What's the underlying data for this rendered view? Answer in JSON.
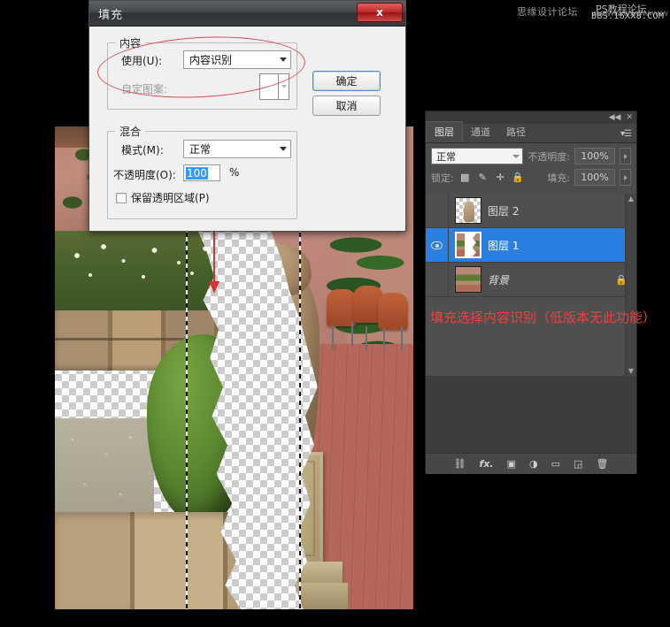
{
  "watermark": {
    "left_text": "思缘设计论坛",
    "dots": "wwwwwwwwwwww",
    "right_line1": "PS教程论坛",
    "right_line2": "BBS.16XX8.COM"
  },
  "dialog": {
    "title": "填充",
    "close_label": "x",
    "contents": {
      "legend": "内容",
      "use_label": "使用(U):",
      "use_value": "内容识别",
      "pattern_label": "自定图案:"
    },
    "blending": {
      "legend": "混合",
      "mode_label": "模式(M):",
      "mode_value": "正常",
      "opacity_label": "不透明度(O):",
      "opacity_value": "100",
      "percent": "%",
      "preserve_label": "保留透明区域(P)"
    },
    "buttons": {
      "ok": "确定",
      "cancel": "取消"
    }
  },
  "layers_panel": {
    "tabs": [
      {
        "label": "图层"
      },
      {
        "label": "通道"
      },
      {
        "label": "路径"
      }
    ],
    "collapse_icon": "◀◀",
    "close_icon": "✕",
    "menu_icon": "▾☰",
    "blend_mode": "正常",
    "opacity_label": "不透明度:",
    "opacity_value": "100%",
    "lock_label": "锁定:",
    "fill_label": "填充:",
    "fill_value": "100%",
    "lock_icons": [
      "transparency-lock-icon",
      "brush-lock-icon",
      "move-lock-icon",
      "all-lock-icon"
    ],
    "layers": [
      {
        "name": "图层 2",
        "visible": false,
        "selected": false,
        "locked": false,
        "thumb": "transparent-statue"
      },
      {
        "name": "图层 1",
        "visible": true,
        "selected": true,
        "locked": false,
        "thumb": "cutout-photo"
      },
      {
        "name": "背景",
        "visible": false,
        "selected": false,
        "locked": true,
        "thumb": "full-photo"
      }
    ],
    "bottom_icons": [
      "link-icon",
      "fx-icon",
      "mask-icon",
      "adjustment-icon",
      "group-icon",
      "new-layer-icon",
      "delete-icon"
    ]
  },
  "annotation": {
    "text": "填充选择内容识别（低版本无此功能）",
    "color": "#ef4040"
  },
  "colors": {
    "selection_blue": "#2b7fe0",
    "annotation_red": "#ef4040",
    "arrow_red": "#d83232",
    "ellipse_red": "#d45050",
    "panel_bg": "#3d3d3d",
    "dialog_bg": "#f0f0f0",
    "close_button_red": "#c02a2a"
  },
  "canvas": {
    "description": "garden photo with content-aware cutout showing transparency checkerboard"
  }
}
